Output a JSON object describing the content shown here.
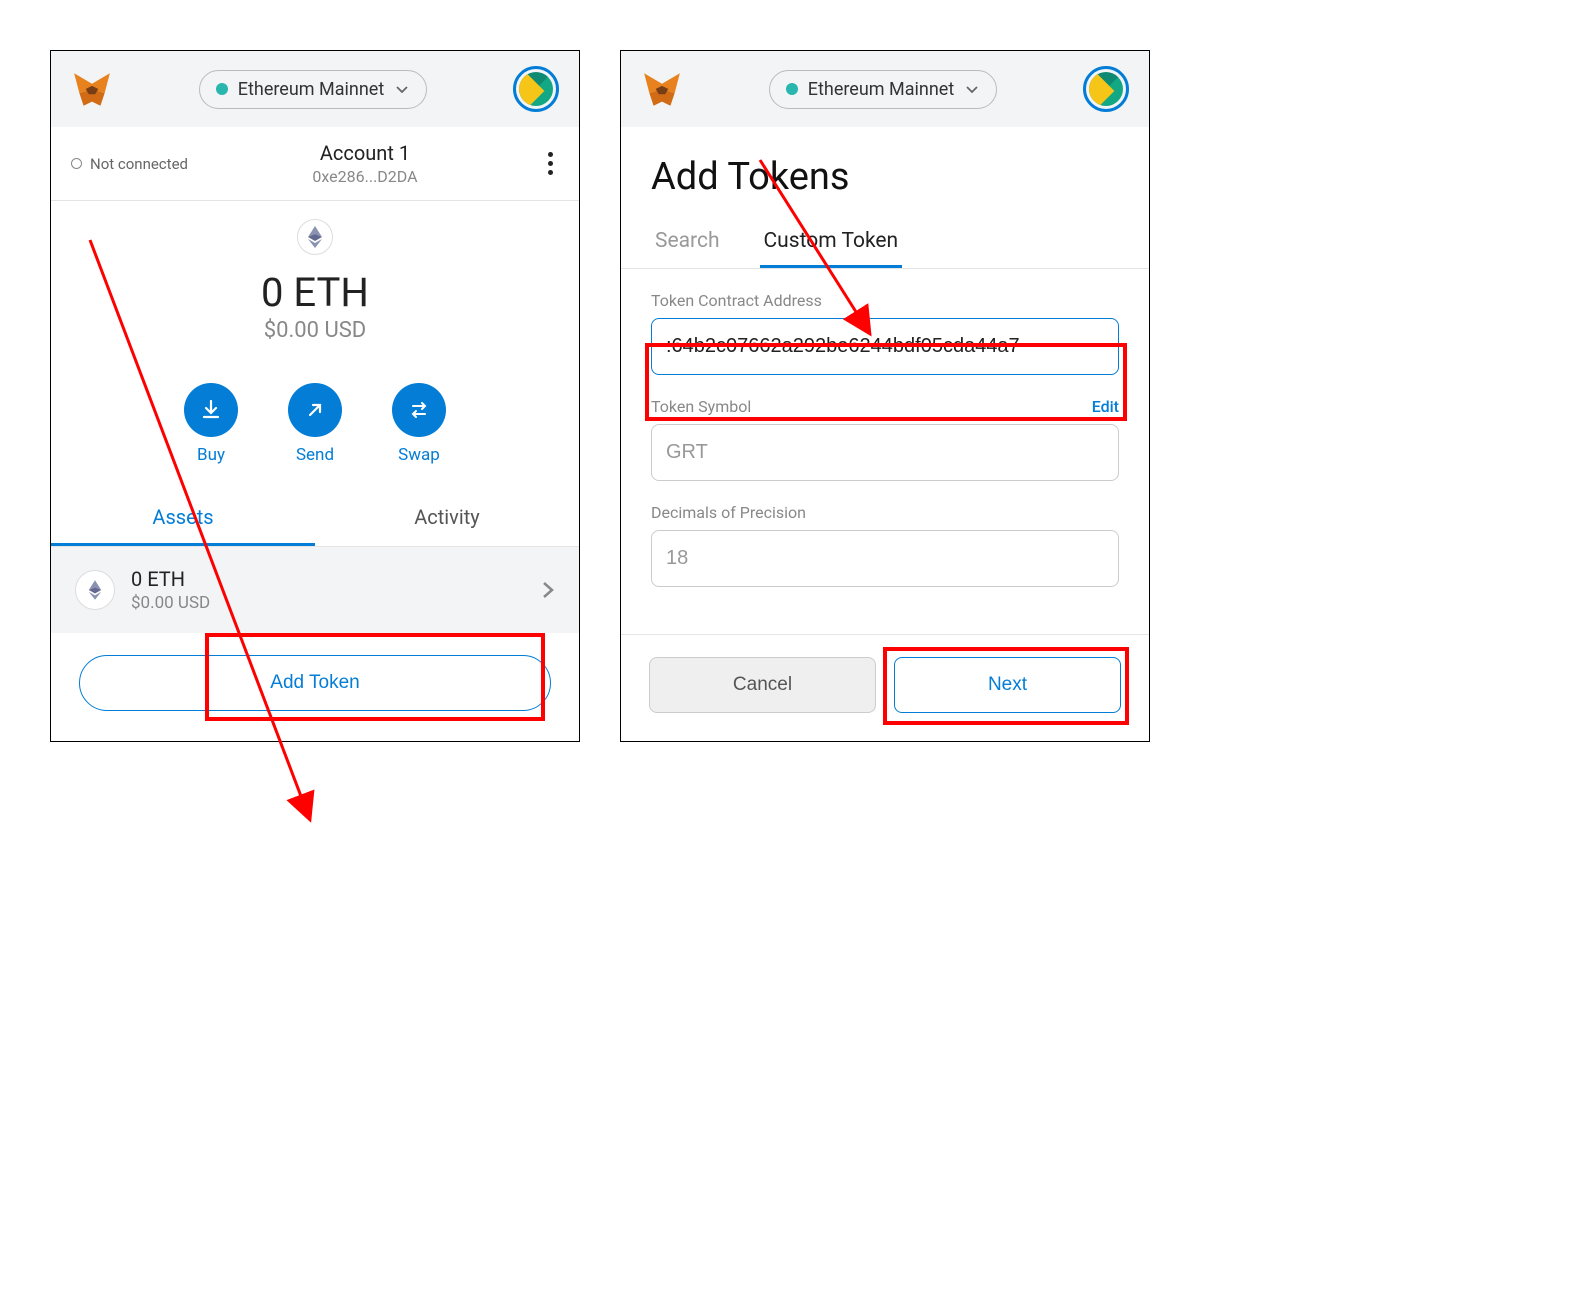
{
  "header": {
    "network_name": "Ethereum Mainnet"
  },
  "left": {
    "not_connected": "Not connected",
    "account_name": "Account 1",
    "account_address": "0xe286...D2DA",
    "balance_main": "0 ETH",
    "balance_fiat": "$0.00 USD",
    "actions": {
      "buy": "Buy",
      "send": "Send",
      "swap": "Swap"
    },
    "tabs": {
      "assets": "Assets",
      "activity": "Activity"
    },
    "asset": {
      "amount": "0 ETH",
      "fiat": "$0.00 USD"
    },
    "add_token": "Add Token"
  },
  "right": {
    "title": "Add Tokens",
    "tabs": {
      "search": "Search",
      "custom": "Custom Token"
    },
    "field_contract_label": "Token Contract Address",
    "field_contract_value": ":64b2c07662a292be6244bdf05cda44a7",
    "field_symbol_label": "Token Symbol",
    "edit_link": "Edit",
    "field_symbol_value": "GRT",
    "field_decimals_label": "Decimals of Precision",
    "field_decimals_value": "18",
    "cancel": "Cancel",
    "next": "Next"
  }
}
